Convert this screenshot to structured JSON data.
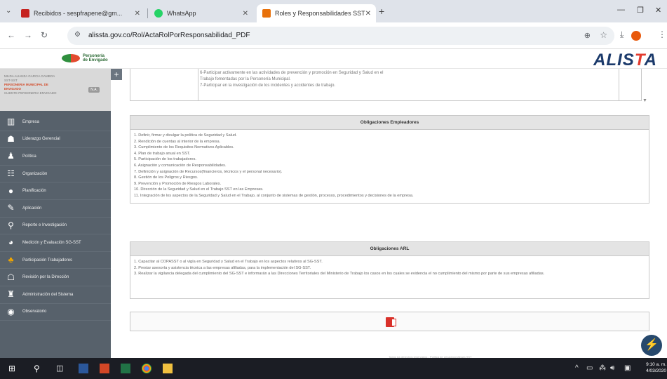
{
  "browser": {
    "tabs": [
      {
        "title": "Recibidos - sespfrapene@gm...",
        "favicon_color": "#c5221f"
      },
      {
        "title": "WhatsApp",
        "favicon_color": "#25d366"
      },
      {
        "title": "Roles y Responsabilidades SST",
        "favicon_color": "#e8710a"
      }
    ],
    "new_tab": "+",
    "url": "alissta.gov.co/Rol/ActaRolPorResponsabilidad_PDF"
  },
  "header": {
    "left_logo_text": "Personería de Envigado",
    "right_logo": "ALISTA"
  },
  "sidebar": {
    "user_lines": [
      "MILDA ALIANZA GARCIA GAMBOA",
      "SST-SST"
    ],
    "org_lines": [
      "PERSONERIA MUNICIPAL DE",
      "ENVIGADO"
    ],
    "small_line": "CLIENTE PERSONERIA ENVIGADO",
    "badge": "N.A.",
    "items": [
      {
        "label": "Empresa",
        "icon": "building-icon"
      },
      {
        "label": "Liderazgo Gerencial",
        "icon": "user-tie-icon"
      },
      {
        "label": "Política",
        "icon": "flag-icon"
      },
      {
        "label": "Organización",
        "icon": "org-chart-icon"
      },
      {
        "label": "Planificación",
        "icon": "planning-icon"
      },
      {
        "label": "Aplicación",
        "icon": "apply-icon"
      },
      {
        "label": "Reporte e Investigación",
        "icon": "search-icon"
      },
      {
        "label": "Medición y Evaluación SG-SST",
        "icon": "chart-icon"
      },
      {
        "label": "Participación Trabajadores",
        "icon": "people-icon"
      },
      {
        "label": "Revisión por la Dirección",
        "icon": "review-icon"
      },
      {
        "label": "Administración del Sistema",
        "icon": "admin-icon"
      },
      {
        "label": "Observatorio",
        "icon": "observatory-icon"
      }
    ]
  },
  "upper_table": {
    "lines": [
      "6-Participar activamente en las actividades de prevención y promoción en Seguridad y Salud en el",
      "Trabajo fomentadas por la Personería Municipal.",
      "7-Participar en la investigación de los incidentes y accidentes de trabajo."
    ]
  },
  "employers": {
    "title": "Obligaciones Empleadores",
    "items": [
      "1. Definir, firmar y divulgar la política de Seguridad y Salud.",
      "2. Rendición de cuentas al interior de la empresa.",
      "3. Cumplimiento de los Requisitos Normativos Aplicables.",
      "4. Plan de trabajo anual en SST.",
      "5. Participación de los trabajadores.",
      "6. Asignación y comunicación de Responsabilidades.",
      "7. Definición y asignación de Recursos(financieros, técnicos y el personal necesario).",
      "8. Gestión de los Peligros y Riesgos.",
      "9. Prevención y Promoción de Riesgos Laborales.",
      "10. Dirección de la Seguridad y Salud en el Trabajo SST en las Empresas.",
      "11. Integración de los aspectos de la Seguridad y Salud en el Trabajo, al conjunto de sistemas de gestión, procesos, procedimientos y decisiones de la empresa."
    ]
  },
  "arl": {
    "title": "Obligaciones ARL",
    "items": [
      "1. Capacitar al COPASST o al vigía en Seguridad y Salud en el Trabajo en los aspectos relativos al SG-SST.",
      "2. Prestar asesoría y asistencia técnica a las empresas afiliadas, para la implementación del SG-SST.",
      "3. Realizar la vigilancia delegada del cumplimiento del SG-SST e informarán a las Direcciones Territoriales del Ministerio de Trabajo los casos en los cuales se evidencia el no cumplimiento del mismo por parte de sus empresas afiliadas."
    ]
  },
  "footer_note": "Todos los derechos reservados - Política de privacidad Alissta SST",
  "taskbar": {
    "time": "9:10 a. m.",
    "date": "4/03/2020"
  }
}
